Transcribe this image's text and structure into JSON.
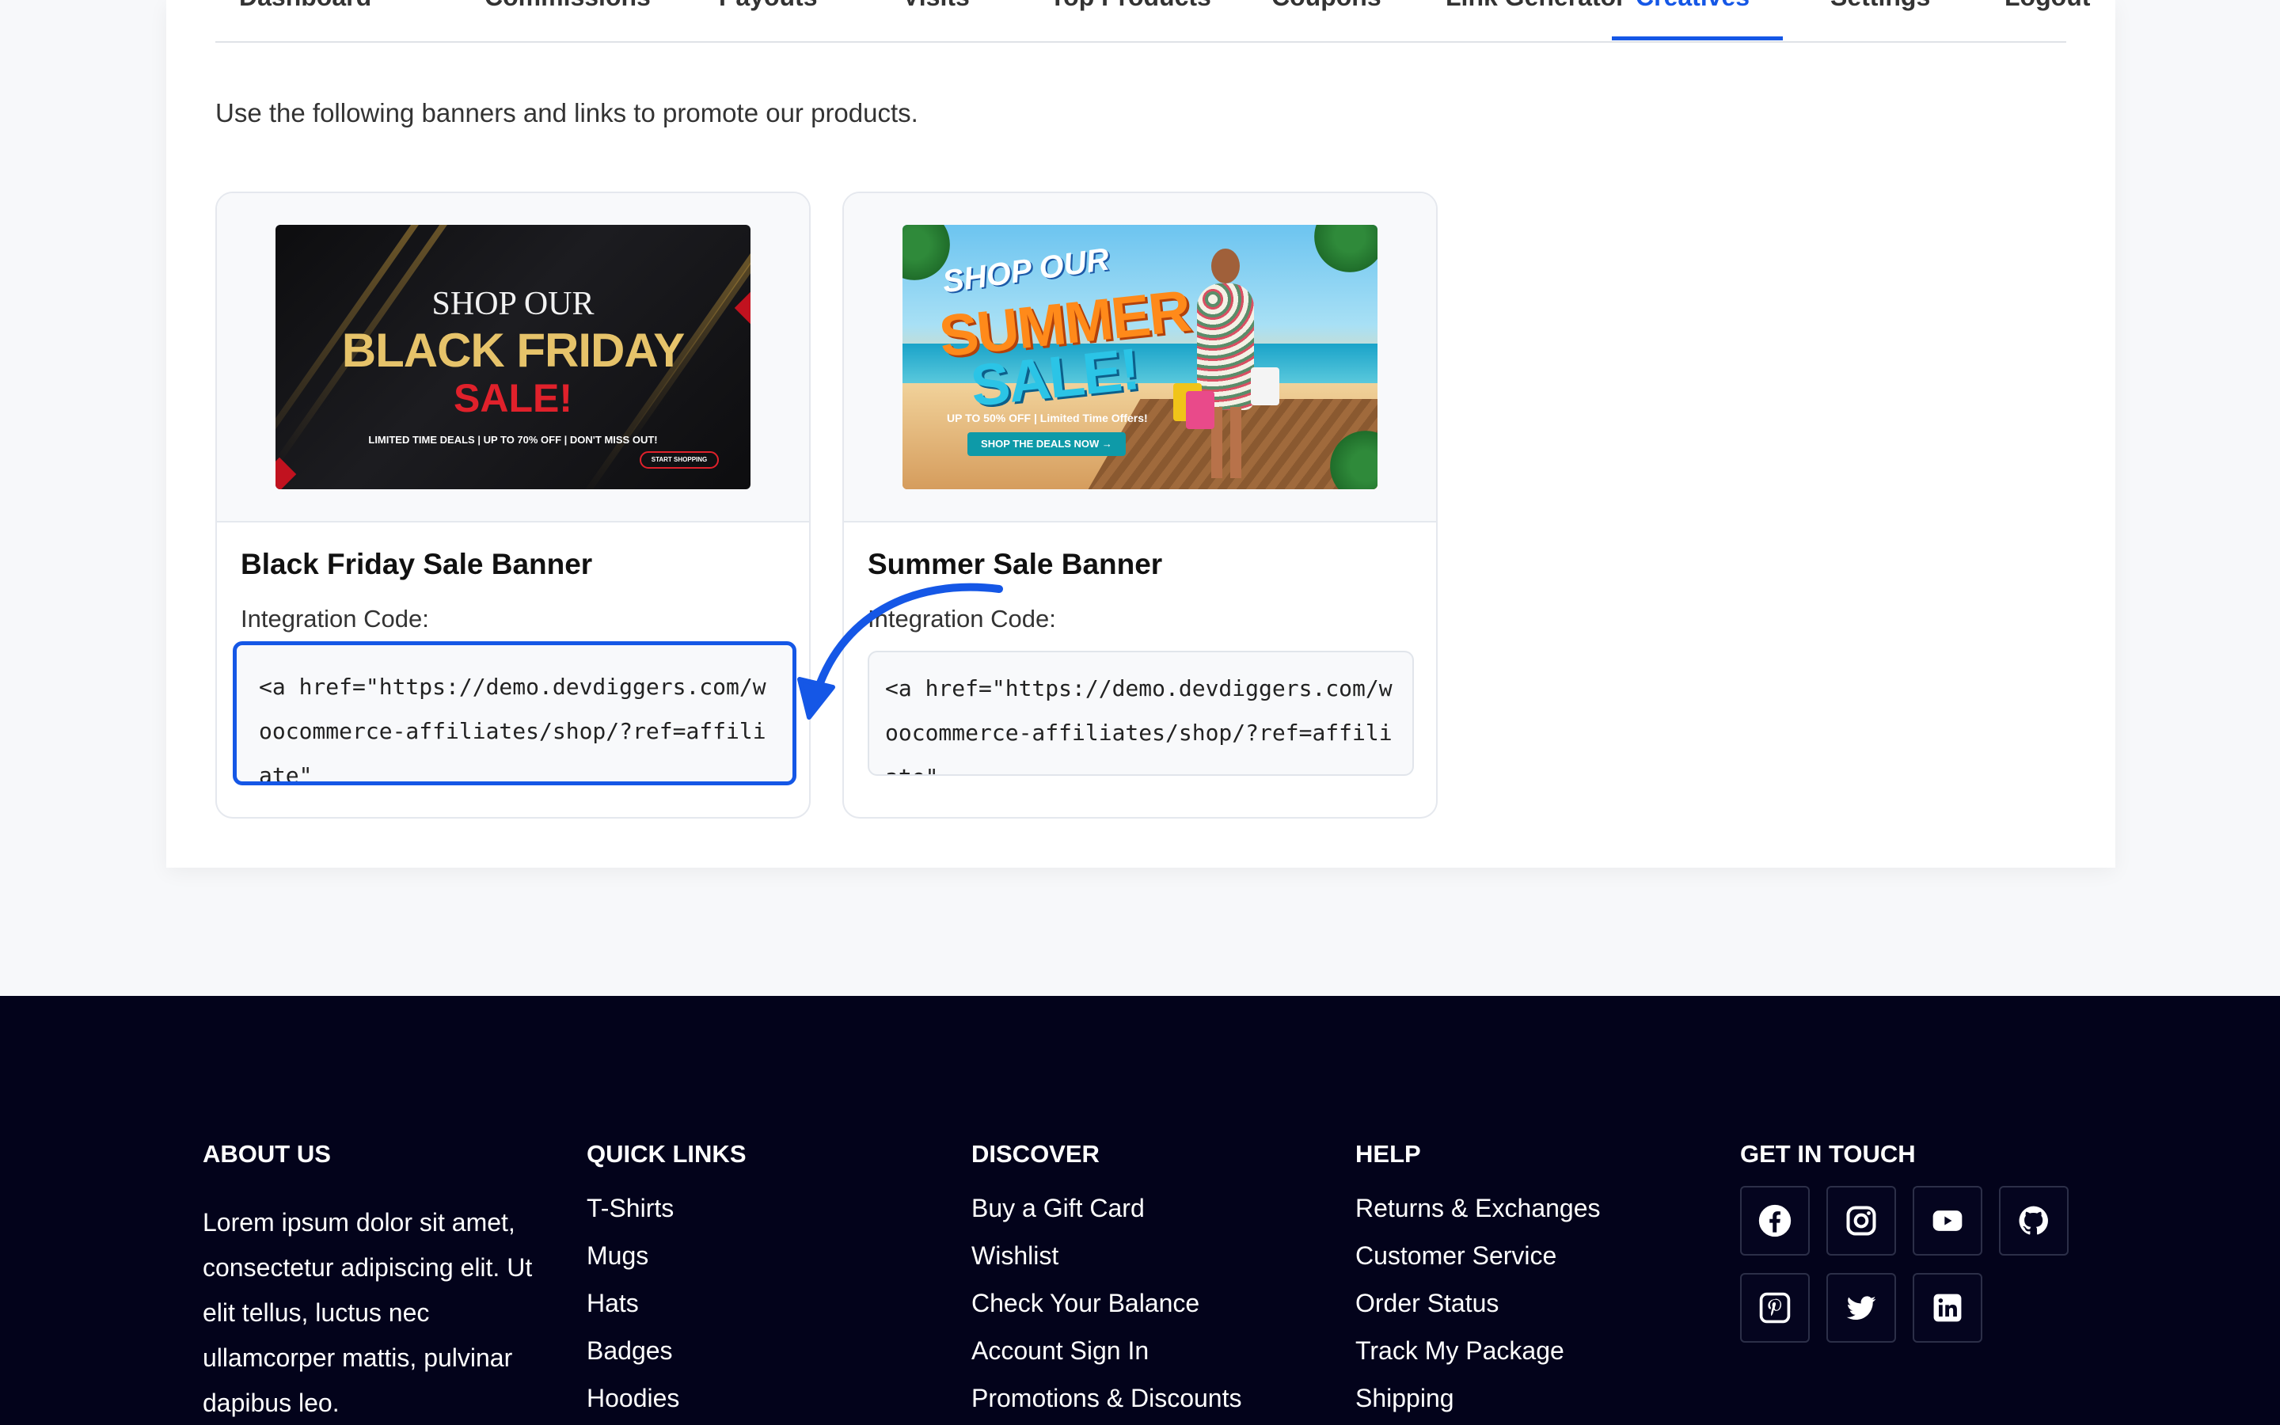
{
  "tabs": [
    {
      "label": "Dashboard"
    },
    {
      "label": "Commissions"
    },
    {
      "label": "Payouts"
    },
    {
      "label": "Visits"
    },
    {
      "label": "Top Products"
    },
    {
      "label": "Coupons"
    },
    {
      "label": "Link Generator"
    },
    {
      "label": "Creatives",
      "active": true
    },
    {
      "label": "Settings"
    },
    {
      "label": "Logout"
    }
  ],
  "intro": "Use the following banners and links to promote our products.",
  "creatives": [
    {
      "title": "Black Friday Sale Banner",
      "code_label": "Integration Code:",
      "code": "<a href=\"https://demo.devdiggers.com/woocommerce-affiliates/shop/?ref=affiliate\"",
      "banner": {
        "line1": "SHOP OUR",
        "line2": "BLACK FRIDAY",
        "line3": "SALE!",
        "tagline": "LIMITED TIME DEALS | UP TO 70% OFF | DON'T MISS OUT!",
        "button": "START SHOPPING"
      }
    },
    {
      "title": "Summer Sale Banner",
      "code_label": "Integration Code:",
      "code": "<a href=\"https://demo.devdiggers.com/woocommerce-affiliates/shop/?ref=affiliate\"",
      "banner": {
        "line1": "SHOP OUR",
        "line2": "SUMMER",
        "line3": "SALE!",
        "tagline": "UP TO 50% OFF | Limited Time Offers!",
        "button": "SHOP THE DEALS NOW →"
      }
    }
  ],
  "footer": {
    "about": {
      "heading": "ABOUT US",
      "text": "Lorem ipsum dolor sit amet, consectetur adipiscing elit. Ut elit tellus, luctus nec ullamcorper mattis, pulvinar dapibus leo."
    },
    "quick_links": {
      "heading": "QUICK LINKS",
      "items": [
        "T-Shirts",
        "Mugs",
        "Hats",
        "Badges",
        "Hoodies"
      ]
    },
    "discover": {
      "heading": "DISCOVER",
      "items": [
        "Buy a Gift Card",
        "Wishlist",
        "Check Your Balance",
        "Account Sign In",
        "Promotions & Discounts"
      ]
    },
    "help": {
      "heading": "HELP",
      "items": [
        "Returns & Exchanges",
        "Customer Service",
        "Order Status",
        "Track My Package",
        "Shipping"
      ]
    },
    "contact": {
      "heading": "GET IN TOUCH",
      "icons": [
        "facebook-icon",
        "instagram-icon",
        "youtube-icon",
        "github-icon",
        "pinterest-icon",
        "twitter-icon",
        "linkedin-icon"
      ]
    }
  },
  "colors": {
    "accent": "#1557e6",
    "footer_bg": "#03031b"
  }
}
